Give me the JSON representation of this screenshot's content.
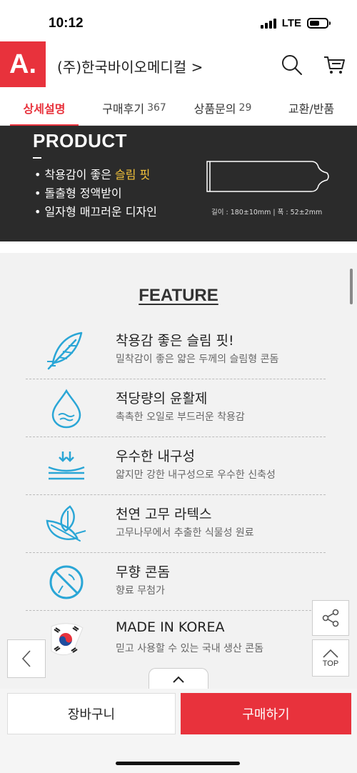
{
  "status_bar": {
    "time": "10:12",
    "network": "LTE"
  },
  "header": {
    "logo": "A.",
    "store_name": "(주)한국바이오메디컬 >",
    "search_icon": "search-icon",
    "cart_icon": "cart-icon"
  },
  "tabs": [
    {
      "label": "상세설명",
      "count": ""
    },
    {
      "label": "구매후기",
      "count": "367"
    },
    {
      "label": "상품문의",
      "count": "29"
    },
    {
      "label": "교환/반품",
      "count": ""
    }
  ],
  "product": {
    "heading": "PRODUCT",
    "bullets": [
      {
        "prefix": "• 착용감이 좋은 ",
        "highlight": "슬림 핏"
      },
      {
        "prefix": "• 돌출형 정액받이",
        "highlight": ""
      },
      {
        "prefix": "• 일자형 매끄러운 디자인",
        "highlight": ""
      }
    ],
    "dimensions": "길이 : 180±10mm | 폭 : 52±2mm",
    "accent_color": "#f3c33b"
  },
  "feature": {
    "heading": "FEATURE",
    "items": [
      {
        "title": "착용감 좋은 슬림 핏!",
        "desc": "밀착감이 좋은 얇은 두께의 슬림형 콘돔",
        "icon": "feather-icon"
      },
      {
        "title": "적당량의 윤활제",
        "desc": "촉촉한 오일로 부드러운 착용감",
        "icon": "water-drop-icon"
      },
      {
        "title": "우수한 내구성",
        "desc": "얇지만 강한 내구성으로 우수한 신축성",
        "icon": "stretch-icon"
      },
      {
        "title": "천연 고무 라텍스",
        "desc": "고무나무에서 추출한 식물성 원료",
        "icon": "leaf-icon"
      },
      {
        "title": "무향 콘돔",
        "desc": "향료 무첨가",
        "icon": "no-fragrance-icon"
      },
      {
        "title": "MADE IN KOREA",
        "desc": "믿고 사용할 수 있는 국내 생산 콘돔",
        "icon": "korea-flag-icon"
      }
    ],
    "icon_color": "#2aa6d6"
  },
  "floating": {
    "top_label": "TOP"
  },
  "bottom_bar": {
    "cart_label": "장바구니",
    "buy_label": "구매하기",
    "brand_color": "#e8323c"
  }
}
